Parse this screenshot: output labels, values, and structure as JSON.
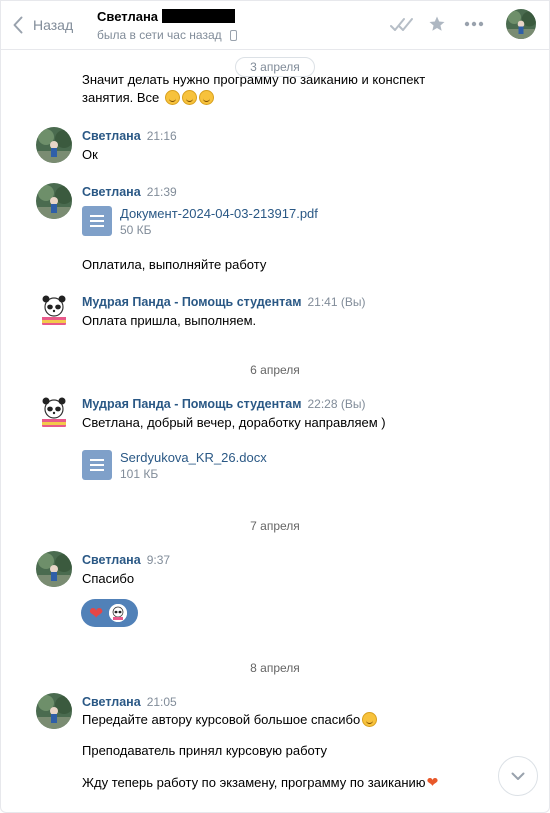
{
  "header": {
    "back_label": "Назад",
    "peer_name": "Светлана",
    "peer_status": "была в сети час назад"
  },
  "colors": {
    "link": "#2a5885",
    "muted": "#818c99",
    "doc_icon": "#7fa0c9",
    "reaction_bg": "#5181b8"
  },
  "dates": {
    "d1": "3 апреля",
    "d2": "6 апреля",
    "d3": "7 апреля",
    "d4": "8 апреля"
  },
  "messages": {
    "m0_text": "Значит делать нужно программу по заиканию и конспект",
    "m0_text2": "занятия. Все",
    "m1": {
      "author": "Светлана",
      "time": "21:16",
      "text": "Ок"
    },
    "m2": {
      "author": "Светлана",
      "time": "21:39",
      "doc_name": "Документ-2024-04-03-213917.pdf",
      "doc_size": "50 КБ",
      "text": "Оплатила, выполняйте работу"
    },
    "m3": {
      "author": "Мудрая Панда - Помощь студентам",
      "time": "21:41 (Вы)",
      "text": "Оплата пришла, выполняем."
    },
    "m4": {
      "author": "Мудрая Панда - Помощь студентам",
      "time": "22:28 (Вы)",
      "text": "Светлана, добрый вечер, доработку направляем )",
      "doc_name": "Serdyukova_KR_26.docx",
      "doc_size": "101 КБ"
    },
    "m5": {
      "author": "Светлана",
      "time": "9:37",
      "text": "Спасибо"
    },
    "m6": {
      "author": "Светлана",
      "time": "21:05",
      "text1": "Передайте автору курсовой большое спасибо",
      "text2": "Преподаватель принял курсовую работу",
      "text3": "Жду теперь работу по экзамену, программу по заиканию"
    }
  },
  "icons": [
    "chevron-left-icon",
    "phone-icon",
    "read-checks-icon",
    "star-icon",
    "more-icon",
    "document-icon",
    "heart-icon",
    "smile-icon",
    "chevron-down-icon"
  ]
}
